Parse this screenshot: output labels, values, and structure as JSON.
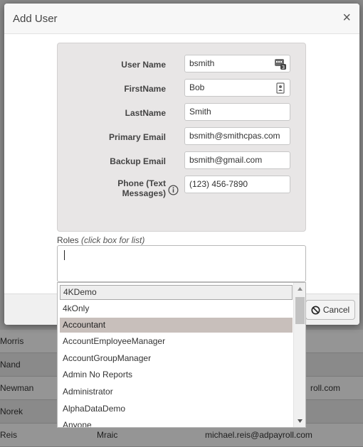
{
  "background_table": {
    "rows": [
      {
        "a": "Morris",
        "b": "",
        "c": ""
      },
      {
        "a": "Nand",
        "b": "",
        "c": ""
      },
      {
        "a": "Newman",
        "b": "",
        "c": "roll.com"
      },
      {
        "a": "Norek",
        "b": "",
        "c": ""
      },
      {
        "a": "Reis",
        "b": "Mraic",
        "c": "michael.reis@adpayroll.com"
      }
    ]
  },
  "modal": {
    "title": "Add User",
    "close_glyph": "×",
    "fields": {
      "user_name": {
        "label": "User Name",
        "value": "bsmith",
        "icon": "keyboard-badge-icon"
      },
      "first_name": {
        "label": "FirstName",
        "value": "Bob",
        "icon": "contact-card-icon"
      },
      "last_name": {
        "label": "LastName",
        "value": "Smith"
      },
      "primary_email": {
        "label": "Primary Email",
        "value": "bsmith@smithcpas.com"
      },
      "backup_email": {
        "label": "Backup Email",
        "value": "bsmith@gmail.com"
      },
      "phone": {
        "label_line1": "Phone (Text",
        "label_line2": "Messages)",
        "value": "(123) 456-7890",
        "icon": "info-icon"
      }
    },
    "roles": {
      "label": "Roles",
      "hint": "(click box for list)"
    },
    "cancel_label": "Cancel"
  },
  "dropdown": {
    "items": [
      "4KDemo",
      "4kOnly",
      "Accountant",
      "AccountEmployeeManager",
      "AccountGroupManager",
      "Admin No Reports",
      "Administrator",
      "AlphaDataDemo",
      "Anyone"
    ],
    "selected": "Accountant"
  },
  "colors": {
    "overlay": "#8a8a8a",
    "panel": "#e8e6e6",
    "selected_item": "#c8bfbb"
  }
}
